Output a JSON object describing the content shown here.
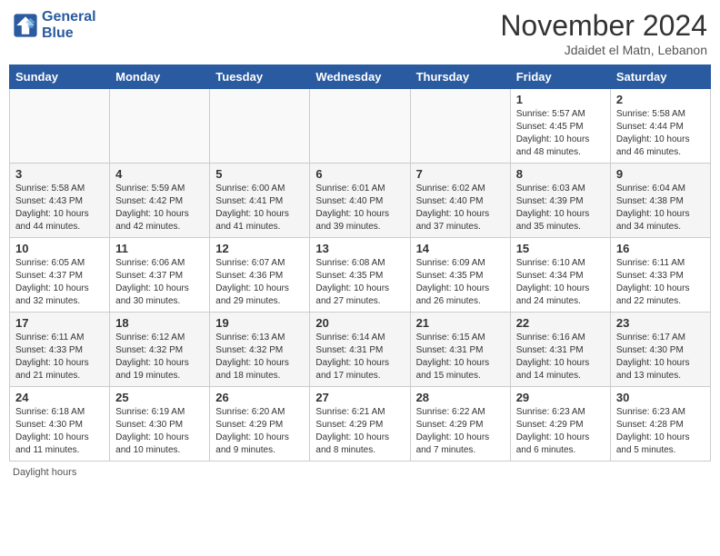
{
  "header": {
    "logo_line1": "General",
    "logo_line2": "Blue",
    "month_title": "November 2024",
    "location": "Jdaidet el Matn, Lebanon"
  },
  "columns": [
    "Sunday",
    "Monday",
    "Tuesday",
    "Wednesday",
    "Thursday",
    "Friday",
    "Saturday"
  ],
  "weeks": [
    {
      "days": [
        {
          "num": "",
          "info": ""
        },
        {
          "num": "",
          "info": ""
        },
        {
          "num": "",
          "info": ""
        },
        {
          "num": "",
          "info": ""
        },
        {
          "num": "",
          "info": ""
        },
        {
          "num": "1",
          "info": "Sunrise: 5:57 AM\nSunset: 4:45 PM\nDaylight: 10 hours\nand 48 minutes."
        },
        {
          "num": "2",
          "info": "Sunrise: 5:58 AM\nSunset: 4:44 PM\nDaylight: 10 hours\nand 46 minutes."
        }
      ]
    },
    {
      "days": [
        {
          "num": "3",
          "info": "Sunrise: 5:58 AM\nSunset: 4:43 PM\nDaylight: 10 hours\nand 44 minutes."
        },
        {
          "num": "4",
          "info": "Sunrise: 5:59 AM\nSunset: 4:42 PM\nDaylight: 10 hours\nand 42 minutes."
        },
        {
          "num": "5",
          "info": "Sunrise: 6:00 AM\nSunset: 4:41 PM\nDaylight: 10 hours\nand 41 minutes."
        },
        {
          "num": "6",
          "info": "Sunrise: 6:01 AM\nSunset: 4:40 PM\nDaylight: 10 hours\nand 39 minutes."
        },
        {
          "num": "7",
          "info": "Sunrise: 6:02 AM\nSunset: 4:40 PM\nDaylight: 10 hours\nand 37 minutes."
        },
        {
          "num": "8",
          "info": "Sunrise: 6:03 AM\nSunset: 4:39 PM\nDaylight: 10 hours\nand 35 minutes."
        },
        {
          "num": "9",
          "info": "Sunrise: 6:04 AM\nSunset: 4:38 PM\nDaylight: 10 hours\nand 34 minutes."
        }
      ]
    },
    {
      "days": [
        {
          "num": "10",
          "info": "Sunrise: 6:05 AM\nSunset: 4:37 PM\nDaylight: 10 hours\nand 32 minutes."
        },
        {
          "num": "11",
          "info": "Sunrise: 6:06 AM\nSunset: 4:37 PM\nDaylight: 10 hours\nand 30 minutes."
        },
        {
          "num": "12",
          "info": "Sunrise: 6:07 AM\nSunset: 4:36 PM\nDaylight: 10 hours\nand 29 minutes."
        },
        {
          "num": "13",
          "info": "Sunrise: 6:08 AM\nSunset: 4:35 PM\nDaylight: 10 hours\nand 27 minutes."
        },
        {
          "num": "14",
          "info": "Sunrise: 6:09 AM\nSunset: 4:35 PM\nDaylight: 10 hours\nand 26 minutes."
        },
        {
          "num": "15",
          "info": "Sunrise: 6:10 AM\nSunset: 4:34 PM\nDaylight: 10 hours\nand 24 minutes."
        },
        {
          "num": "16",
          "info": "Sunrise: 6:11 AM\nSunset: 4:33 PM\nDaylight: 10 hours\nand 22 minutes."
        }
      ]
    },
    {
      "days": [
        {
          "num": "17",
          "info": "Sunrise: 6:11 AM\nSunset: 4:33 PM\nDaylight: 10 hours\nand 21 minutes."
        },
        {
          "num": "18",
          "info": "Sunrise: 6:12 AM\nSunset: 4:32 PM\nDaylight: 10 hours\nand 19 minutes."
        },
        {
          "num": "19",
          "info": "Sunrise: 6:13 AM\nSunset: 4:32 PM\nDaylight: 10 hours\nand 18 minutes."
        },
        {
          "num": "20",
          "info": "Sunrise: 6:14 AM\nSunset: 4:31 PM\nDaylight: 10 hours\nand 17 minutes."
        },
        {
          "num": "21",
          "info": "Sunrise: 6:15 AM\nSunset: 4:31 PM\nDaylight: 10 hours\nand 15 minutes."
        },
        {
          "num": "22",
          "info": "Sunrise: 6:16 AM\nSunset: 4:31 PM\nDaylight: 10 hours\nand 14 minutes."
        },
        {
          "num": "23",
          "info": "Sunrise: 6:17 AM\nSunset: 4:30 PM\nDaylight: 10 hours\nand 13 minutes."
        }
      ]
    },
    {
      "days": [
        {
          "num": "24",
          "info": "Sunrise: 6:18 AM\nSunset: 4:30 PM\nDaylight: 10 hours\nand 11 minutes."
        },
        {
          "num": "25",
          "info": "Sunrise: 6:19 AM\nSunset: 4:30 PM\nDaylight: 10 hours\nand 10 minutes."
        },
        {
          "num": "26",
          "info": "Sunrise: 6:20 AM\nSunset: 4:29 PM\nDaylight: 10 hours\nand 9 minutes."
        },
        {
          "num": "27",
          "info": "Sunrise: 6:21 AM\nSunset: 4:29 PM\nDaylight: 10 hours\nand 8 minutes."
        },
        {
          "num": "28",
          "info": "Sunrise: 6:22 AM\nSunset: 4:29 PM\nDaylight: 10 hours\nand 7 minutes."
        },
        {
          "num": "29",
          "info": "Sunrise: 6:23 AM\nSunset: 4:29 PM\nDaylight: 10 hours\nand 6 minutes."
        },
        {
          "num": "30",
          "info": "Sunrise: 6:23 AM\nSunset: 4:28 PM\nDaylight: 10 hours\nand 5 minutes."
        }
      ]
    }
  ],
  "footer": "Daylight hours"
}
